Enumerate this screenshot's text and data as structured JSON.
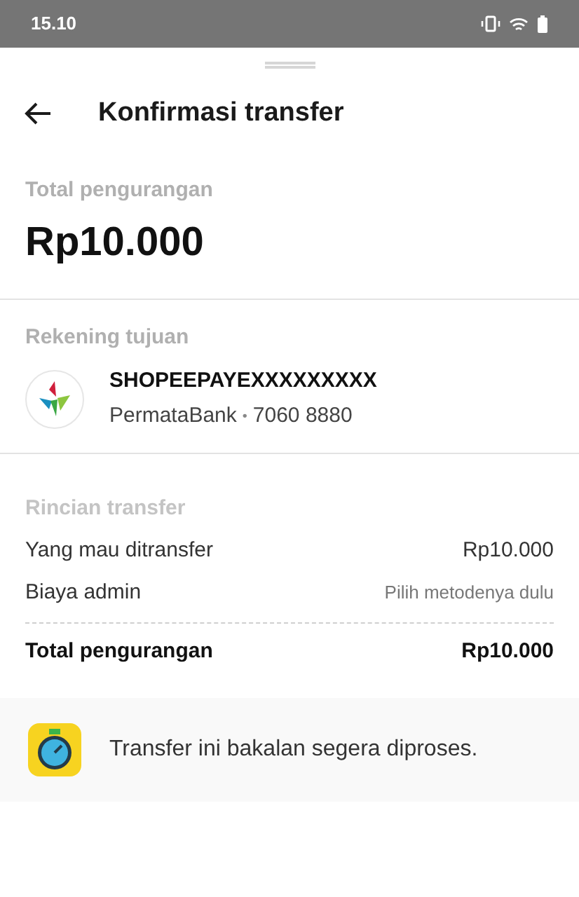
{
  "status_bar": {
    "time": "15.10"
  },
  "header": {
    "title": "Konfirmasi transfer"
  },
  "total": {
    "label": "Total pengurangan",
    "amount": "Rp10.000"
  },
  "destination": {
    "label": "Rekening tujuan",
    "account_name": "SHOPEEPAYEXXXXXXXXX",
    "bank": "PermataBank",
    "separator": "•",
    "account_number": "7060 8880"
  },
  "details": {
    "label": "Rincian transfer",
    "rows": [
      {
        "kind": "normal",
        "label": "Yang mau ditransfer",
        "value": "Rp10.000"
      },
      {
        "kind": "hint",
        "label": "Biaya admin",
        "value": "Pilih metodenya dulu"
      },
      {
        "kind": "total",
        "label": "Total pengurangan",
        "value": "Rp10.000"
      }
    ]
  },
  "notice": {
    "text": "Transfer ini bakalan segera diproses."
  }
}
